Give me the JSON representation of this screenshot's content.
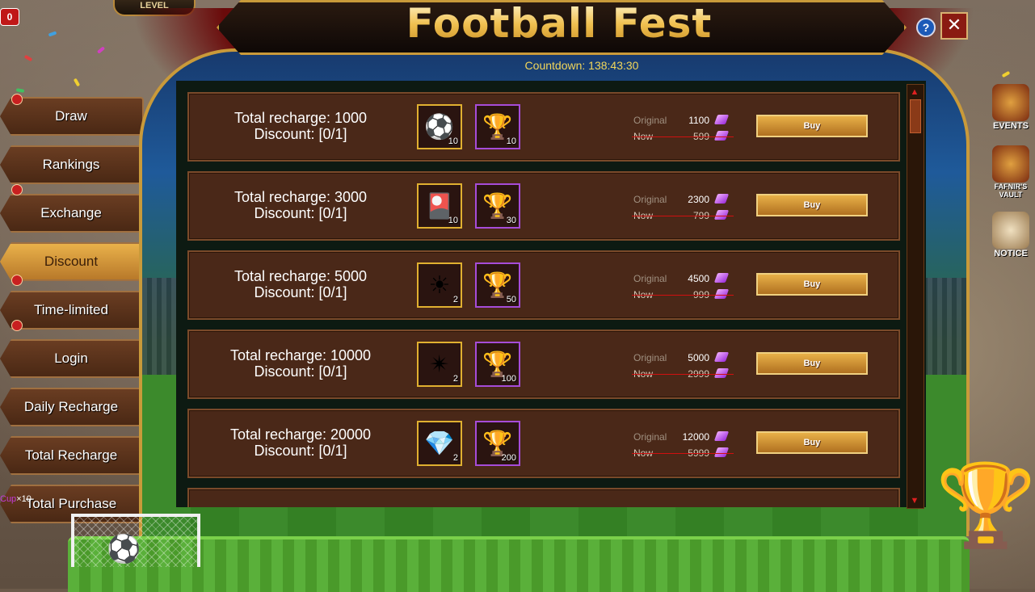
{
  "app": {
    "title": "Football Fest",
    "countdown": "Countdown: 138:43:30",
    "help_label": "?",
    "close_label": "✕",
    "level_label": "LEVEL",
    "top_left_badge": "0",
    "cup_counter": {
      "item": "Cup",
      "count": "×10"
    }
  },
  "sidebar": {
    "items": [
      {
        "label": "Draw",
        "dot": true,
        "active": false
      },
      {
        "label": "Rankings",
        "dot": false,
        "active": false
      },
      {
        "label": "Exchange",
        "dot": true,
        "active": false
      },
      {
        "label": "Discount",
        "dot": false,
        "active": true
      },
      {
        "label": "Time-limited",
        "dot": true,
        "active": false
      },
      {
        "label": "Login",
        "dot": true,
        "active": false
      },
      {
        "label": "Daily Recharge",
        "dot": false,
        "active": false
      },
      {
        "label": "Total Recharge",
        "dot": false,
        "active": false
      },
      {
        "label": "Total Purchase",
        "dot": false,
        "active": false
      }
    ]
  },
  "offers": [
    {
      "recharge": "Total recharge: 1000",
      "discount": "Discount: [0/1]",
      "item1": {
        "icon": "soccer-ball-icon",
        "qty": "10"
      },
      "item2": {
        "icon": "trophy-icon",
        "qty": "10"
      },
      "original_label": "Original",
      "original": "1100",
      "now_label": "Now",
      "now": "599",
      "buy": "Buy"
    },
    {
      "recharge": "Total recharge: 3000",
      "discount": "Discount: [0/1]",
      "item1": {
        "icon": "card-icon",
        "qty": "10"
      },
      "item2": {
        "icon": "trophy-icon",
        "qty": "30"
      },
      "original_label": "Original",
      "original": "2300",
      "now_label": "Now",
      "now": "799",
      "buy": "Buy"
    },
    {
      "recharge": "Total recharge: 5000",
      "discount": "Discount: [0/1]",
      "item1": {
        "icon": "sun-emblem-icon",
        "qty": "2"
      },
      "item2": {
        "icon": "trophy-icon",
        "qty": "50"
      },
      "original_label": "Original",
      "original": "4500",
      "now_label": "Now",
      "now": "999",
      "buy": "Buy"
    },
    {
      "recharge": "Total recharge: 10000",
      "discount": "Discount: [0/1]",
      "item1": {
        "icon": "star-crystal-icon",
        "qty": "2"
      },
      "item2": {
        "icon": "trophy-icon",
        "qty": "100"
      },
      "original_label": "Original",
      "original": "5000",
      "now_label": "Now",
      "now": "2999",
      "buy": "Buy"
    },
    {
      "recharge": "Total recharge: 20000",
      "discount": "Discount: [0/1]",
      "item1": {
        "icon": "blue-crystal-icon",
        "qty": "2"
      },
      "item2": {
        "icon": "trophy-icon",
        "qty": "200"
      },
      "original_label": "Original",
      "original": "12000",
      "now_label": "Now",
      "now": "5999",
      "buy": "Buy"
    }
  ],
  "side_icons": [
    {
      "label": "EVENTS"
    },
    {
      "label": "FAFNIR'S VAULT"
    },
    {
      "label": "NOTICE"
    }
  ],
  "colors": {
    "accent_gold": "#c99a3a",
    "gem_purple": "#a64cd8",
    "strike_red": "#d01010",
    "countdown_yellow": "#f2d65a"
  }
}
